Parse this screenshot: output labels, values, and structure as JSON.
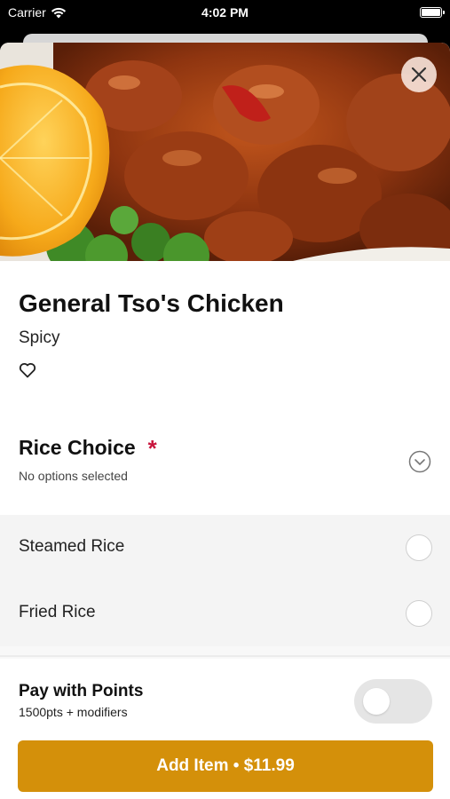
{
  "status_bar": {
    "carrier": "Carrier",
    "time": "4:02 PM",
    "icons": [
      "wifi-icon",
      "battery-icon"
    ]
  },
  "item": {
    "name": "General Tso's Chicken",
    "tag": "Spicy",
    "image_alt_icon": "food-photo"
  },
  "close": {
    "icon": "close-icon"
  },
  "favorite": {
    "icon": "heart-outline-icon"
  },
  "rice_choice": {
    "title": "Rice Choice",
    "required_mark": "*",
    "status": "No options selected",
    "expand_icon": "chevron-down-circle-icon",
    "options": [
      {
        "label": "Steamed Rice",
        "selected": false
      },
      {
        "label": "Fried Rice",
        "selected": false
      }
    ]
  },
  "points": {
    "title": "Pay with Points",
    "detail": "1500pts + modifiers",
    "enabled": false
  },
  "add_button": {
    "label": "Add Item • $11.99"
  },
  "colors": {
    "accent": "#d4900a",
    "required": "#c8143c",
    "options_bg": "#f4f4f4",
    "toggle_off": "#e5e5e5"
  }
}
